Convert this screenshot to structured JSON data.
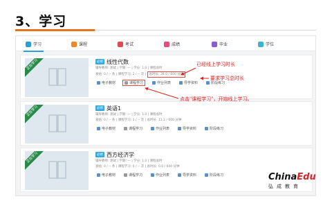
{
  "slide": {
    "title": "3、学习"
  },
  "tabs": [
    {
      "label": "学习",
      "color": "#2aa0d8",
      "icon": "book-icon"
    },
    {
      "label": "课程",
      "color": "#f08a24",
      "icon": "course-icon"
    },
    {
      "label": "考试",
      "color": "#e34b4b",
      "icon": "exam-icon"
    },
    {
      "label": "成绩",
      "color": "#e44c7a",
      "icon": "grade-icon"
    },
    {
      "label": "毕业",
      "color": "#8a5bd1",
      "icon": "graduation-icon"
    },
    {
      "label": "学位",
      "color": "#3db5c9",
      "icon": "degree-icon"
    }
  ],
  "courses": [
    {
      "ribbon": "正在学习",
      "badge": "必修",
      "name": "线性代数",
      "meta1": "辅导教师: 测试  |  学期: 一  |  学分: 1.0  |  课程总时",
      "meta2_left": "发帖: 0 / -- 条  |  课程学习: 2 / -- 次  |",
      "stat": "总时长: 28.0 / 600 分钟",
      "actions": [
        "电子教材",
        "课程学习",
        "作业列表",
        "导学资料",
        "阶段练习"
      ]
    },
    {
      "ribbon": "正在学习",
      "badge": "必修",
      "name": "英语1",
      "meta1": "辅导教师: 测试  |  学期: 一  |  学分: 1.0  |  课程总时",
      "meta2_left": "发帖: 0 / -- 条  |  课程学习: 1 / -- 次  |",
      "stat": "总时长: 11.2 / 600 分钟",
      "actions": [
        "电子教材",
        "课程学习",
        "作业列表",
        "导学资料",
        "阶段练习"
      ]
    },
    {
      "ribbon": "正在学习",
      "badge": "必修",
      "name": "西方经济学",
      "meta1": "辅导教师: 测试  |  学期: 一  |  学分: 1.0  |  课程总时",
      "meta2_left": "发帖: 0 / -- 条  |  课程学习: 0 / -- 次  |",
      "stat": "总时长: 0.0 / 600 分钟",
      "actions": [
        "电子教材",
        "课程学习",
        "作业列表",
        "导学资料",
        "阶段练习"
      ]
    }
  ],
  "annotations": {
    "online_time": "已经线上学习时长",
    "total_time": "要求学习总时长",
    "start_study": "点击\"课程学习\"，开始线上学习。"
  },
  "logo": {
    "brand_main": "China",
    "brand_accent": "Edu",
    "subtitle": "弘成教育"
  },
  "colors": {
    "annotation": "#e02020",
    "accent": "#e8731b"
  }
}
